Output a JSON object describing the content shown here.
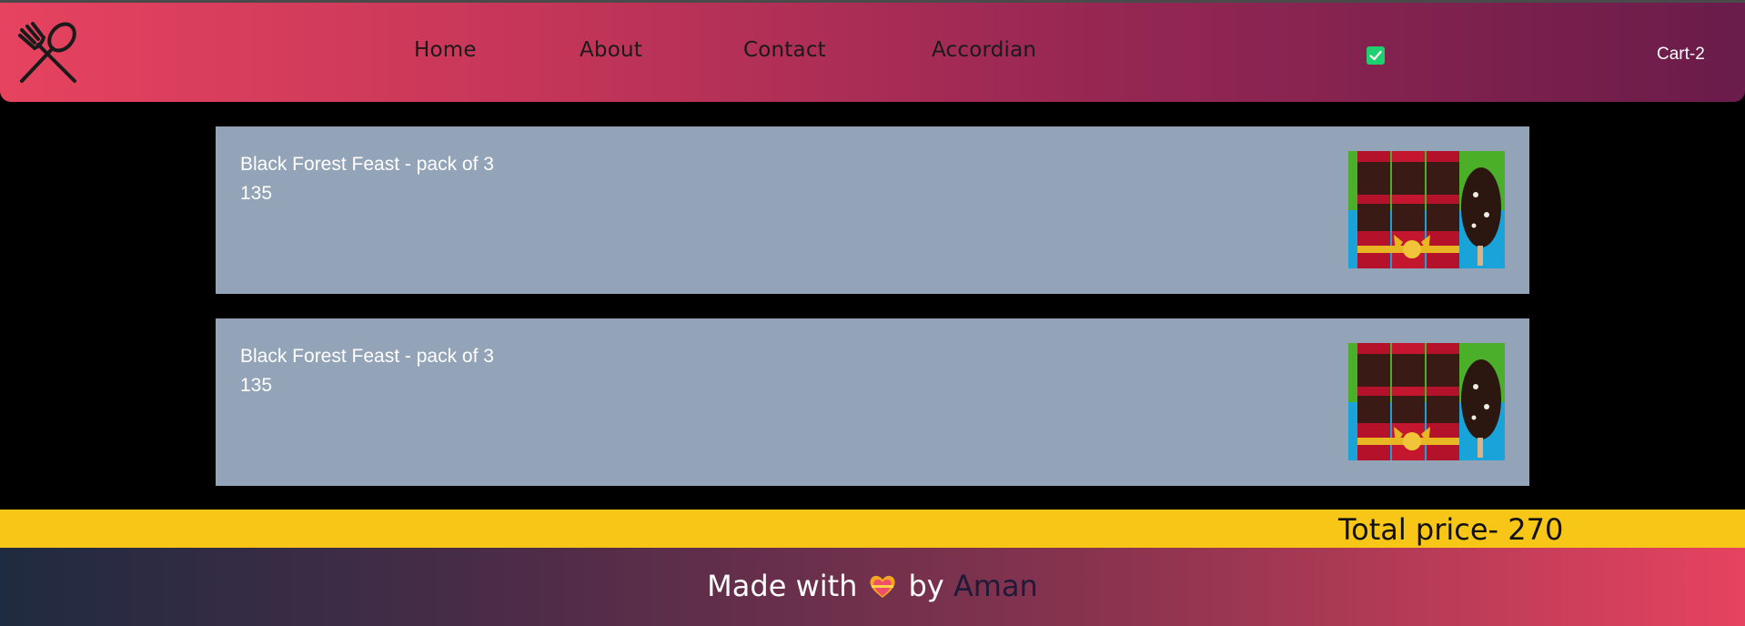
{
  "navbar": {
    "logo_icon": "fork-spoon-icon",
    "links": [
      "Home",
      "About",
      "Contact",
      "Accordian"
    ],
    "checkbox_checked": true,
    "cart_label": "Cart-2"
  },
  "cart_items": [
    {
      "name": "Black Forest Feast - pack of 3",
      "price": "135"
    },
    {
      "name": "Black Forest Feast - pack of 3",
      "price": "135"
    }
  ],
  "total": {
    "label": "Total price- 270"
  },
  "footer": {
    "prefix": "Made with",
    "heart_icon": "heart-icon",
    "by": "by",
    "author": "Aman"
  },
  "colors": {
    "nav_gradient_start": "#e6435f",
    "nav_gradient_end": "#6a1c4a",
    "card_bg": "#93a3b8",
    "total_bar": "#f7c617",
    "checkbox": "#1ed070"
  }
}
